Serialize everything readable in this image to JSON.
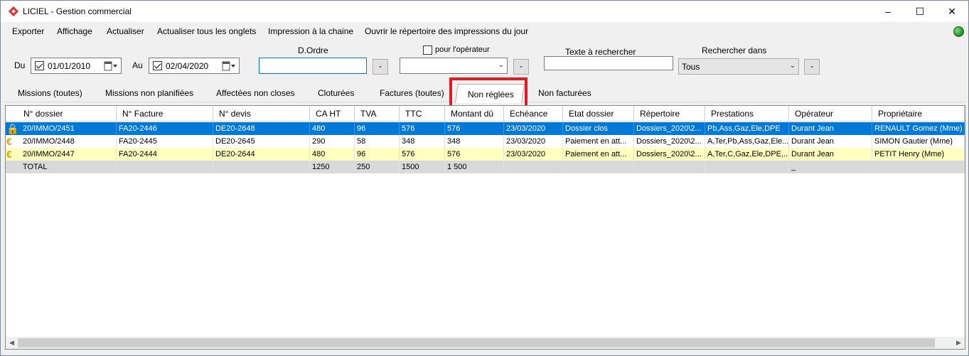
{
  "window": {
    "title": "LICIEL - Gestion commercial",
    "minimize": "–",
    "maximize": "☐",
    "close": "✕"
  },
  "menu": [
    "Exporter",
    "Affichage",
    "Actualiser",
    "Actualiser tous les onglets",
    "Impression à la chaine",
    "Ouvrir le répertoire des impressions du jour"
  ],
  "filters": {
    "du_label": "Du",
    "du_value": "01/01/2010",
    "au_label": "Au",
    "au_value": "02/04/2020",
    "dordre_label": "D.Ordre",
    "dordre_value": "",
    "pour_operateur_label": "pour l'opérateur",
    "operateur_value": "",
    "texte_label": "Texte à rechercher",
    "texte_value": "",
    "rechercher_dans_label": "Rechercher dans",
    "rechercher_dans_value": "Tous",
    "minus": "-"
  },
  "tabs": [
    "Missions (toutes)",
    "Missions non planifiées",
    "Affectées non closes",
    "Cloturées",
    "Factures (toutes)",
    "Non réglées",
    "Non facturées"
  ],
  "active_tab": "Non réglées",
  "table": {
    "columns": [
      "N° dossier",
      "N° Facture",
      "N° devis",
      "CA HT",
      "TVA",
      "TTC",
      "Montant dû",
      "Echéance",
      "Etat dossier",
      "Répertoire",
      "Prestations",
      "Opérateur",
      "Propriétaire"
    ],
    "rows": [
      [
        "20/IMMO/2451",
        "FA20-2446",
        "DE20-2648",
        "480",
        "96",
        "576",
        "576",
        "23/03/2020",
        "Dossier clos",
        "Dossiers_2020\\2...",
        "Pb,Ass,Gaz,Ele,DPE",
        "Durant Jean",
        "RENAULT Gomez (Mme)"
      ],
      [
        "20/IMMO/2448",
        "FA20-2445",
        "DE20-2645",
        "290",
        "58",
        "348",
        "348",
        "23/03/2020",
        "Paiement en att...",
        "Dossiers_2020\\2...",
        "A,Ter,Pb,Ass,Gaz,Ele...",
        "Durant Jean",
        "SIMON Gautier (Mme)"
      ],
      [
        "20/IMMO/2447",
        "FA20-2444",
        "DE20-2644",
        "480",
        "96",
        "576",
        "576",
        "23/03/2020",
        "Paiement en att...",
        "Dossiers_2020\\2...",
        "A,Ter,C,Gaz,Ele,DPE,...",
        "Durant Jean",
        "PETIT Henry (Mme)"
      ]
    ],
    "total": [
      "TOTAL",
      "",
      "",
      "1250",
      "250",
      "1500",
      "1 500",
      "",
      "",
      "",
      "",
      "_",
      ""
    ]
  },
  "colors": {
    "selection": "#0078d7",
    "row_yellow": "#ffffc0",
    "highlight_box": "#e21a22"
  }
}
